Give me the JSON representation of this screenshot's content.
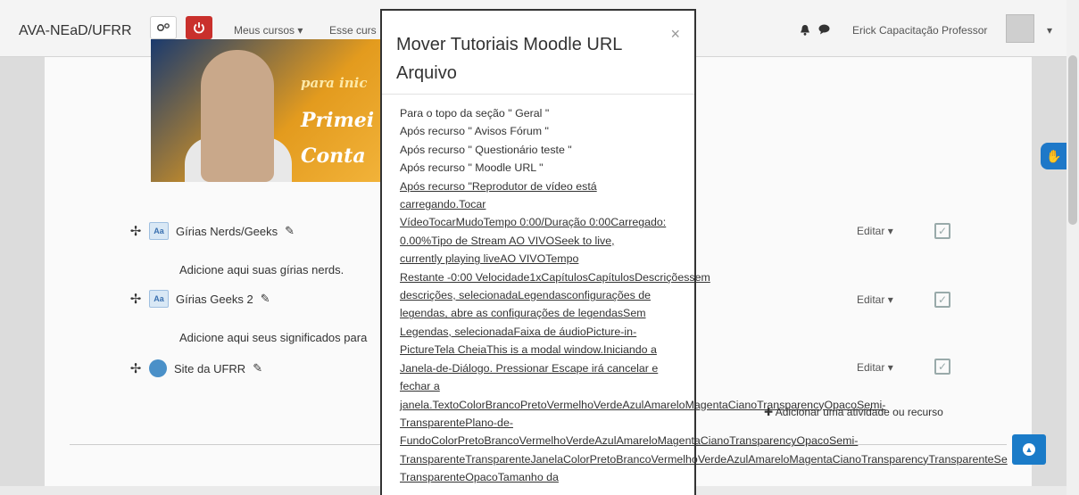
{
  "navbar": {
    "brand": "AVA-NEaD/UFRR",
    "menu_meus_cursos": "Meus cursos",
    "menu_esse_curso": "Esse curs",
    "user_name": "Erick Capacitação Professor"
  },
  "video": {
    "banner_top": "para inic",
    "line1": "Primei",
    "line2": "Conta"
  },
  "activities": [
    {
      "name": "Gírias Nerds/Geeks",
      "description": "Adicione aqui suas gírias nerds.",
      "edit": "Editar"
    },
    {
      "name": "Gírias Geeks 2",
      "description": "Adicione aqui seus significados para",
      "edit": "Editar"
    },
    {
      "name": "Site da UFRR",
      "description": "",
      "edit": "Editar"
    }
  ],
  "add_activity": "Adicionar uma atividade ou recurso",
  "modal": {
    "title": "Mover Tutoriais Moodle URL Arquivo",
    "close": "×",
    "options": [
      "Para o topo da seção \" Geral \"",
      "Após recurso \" Avisos Fórum \"",
      "Após recurso \" Questionário teste \"",
      "Após recurso \" Moodle URL \""
    ],
    "long_link_lines": [
      "Após recurso \"Reprodutor de vídeo está",
      "carregando.Tocar",
      "VídeoTocarMudoTempo 0:00/Duração 0:00Carregado:",
      "0.00%Tipo de Stream AO VIVOSeek to live,",
      "currently playing liveAO VIVOTempo",
      "Restante -0:00 Velocidade1xCapítulosCapítulosDescriçõessem",
      "descrições, selecionadaLegendasconfigurações de",
      "legendas, abre as configurações de legendasSem",
      "Legendas, selecionadaFaixa de áudioPicture-in-",
      "PictureTela CheiaThis is a modal window.Iniciando a",
      "Janela-de-Diálogo. Pressionar Escape irá cancelar e",
      "fechar a",
      "janela.TextoColorBrancoPretoVermelhoVerdeAzulAmareloMagentaCianoTransparencyOpacoSemi-",
      "TransparentePlano-de-",
      "FundoColorPretoBrancoVermelhoVerdeAzulAmareloMagentaCianoTransparencyOpacoSemi-",
      "TransparenteTransparenteJanelaColorPretoBrancoVermelhoVerdeAzulAmareloMagentaCianoTransparencyTransparenteSe",
      "TransparenteOpacoTamanho da"
    ]
  },
  "colors": {
    "danger": "#c9302c",
    "primary": "#1a7bc8"
  }
}
